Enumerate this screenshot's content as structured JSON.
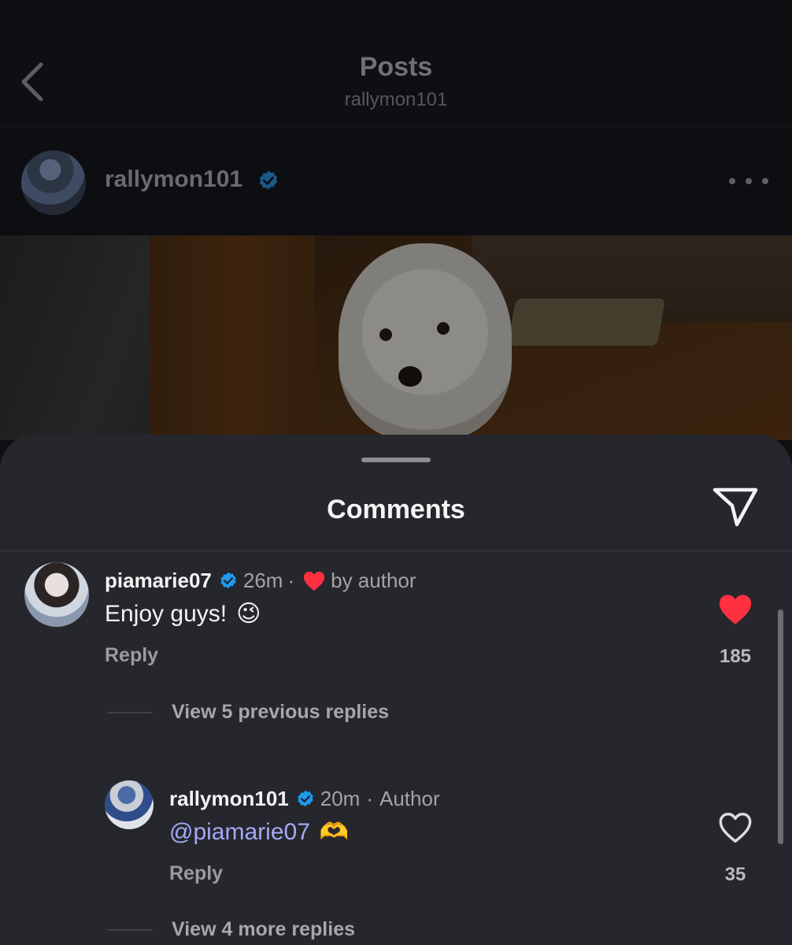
{
  "header": {
    "title": "Posts",
    "subtitle": "rallymon101",
    "back_icon": "chevron-left-icon"
  },
  "post": {
    "username": "rallymon101",
    "verified": true,
    "more_icon": "more-horizontal-icon"
  },
  "comments_sheet": {
    "title": "Comments",
    "share_icon": "send-icon",
    "comment": {
      "username": "piamarie07",
      "time": "26m",
      "separator": "·",
      "liked_by_author_label": "by author",
      "text": "Enjoy guys!",
      "emoji": "😉",
      "reply_label": "Reply",
      "like_count": "185",
      "liked": true
    },
    "view_previous_replies": "View 5 previous replies",
    "reply": {
      "username": "rallymon101",
      "time": "20m",
      "separator": "·",
      "role": "Author",
      "mention": "@piamarie07",
      "emoji": "🫶",
      "reply_label": "Reply",
      "like_count": "35",
      "liked": false
    },
    "view_more_replies": "View 4 more replies"
  },
  "colors": {
    "sheet_bg": "#25272c",
    "verified_blue": "#1d9bf0",
    "like_red": "#ff3040",
    "mention": "#a4a9f7"
  }
}
